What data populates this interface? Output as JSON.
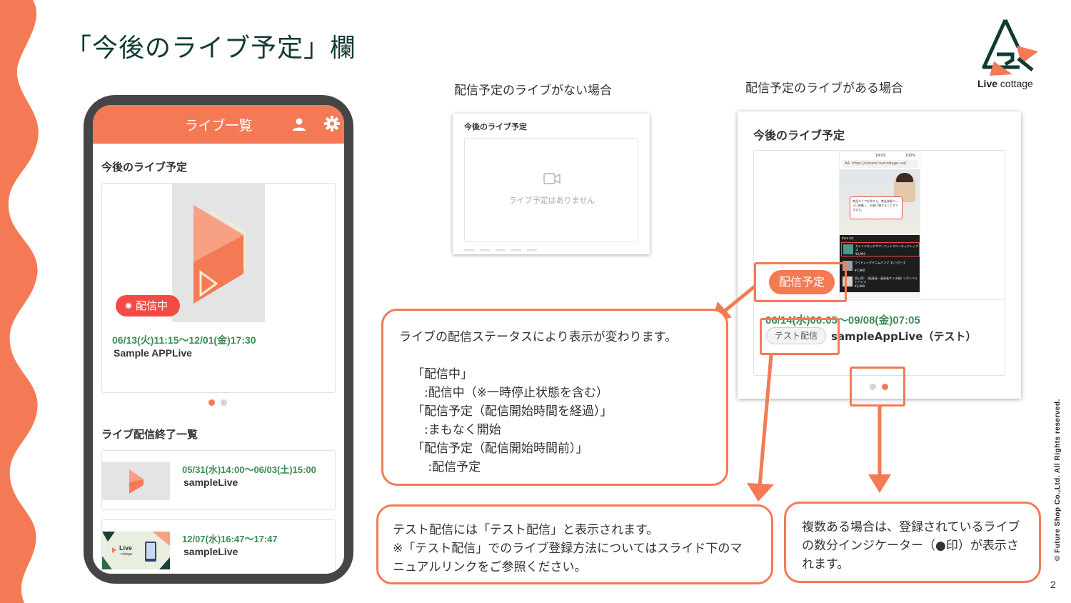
{
  "slide": {
    "title": "「今後のライブ予定」欄",
    "page_number": "2",
    "copyright": "© Future Shop Co.,Ltd. All Rights reserved."
  },
  "logo": {
    "text_bold": "Live",
    "text_regular": "cottage"
  },
  "colors": {
    "accent": "#f47a56",
    "title": "#0f3b33",
    "date_green": "#3d8a55",
    "onair_red": "#f44a45"
  },
  "phone": {
    "header_title": "ライブ一覧",
    "upcoming_title": "今後のライブ予定",
    "live_card": {
      "badge": "配信中",
      "date": "06/13(火)11:15〜12/01(金)17:30",
      "name": "Sample APPLive"
    },
    "ended_title": "ライブ配信終了一覧",
    "ended_items": [
      {
        "date": "05/31(水)14:00〜06/03(土)15:00",
        "name": "sampleLive"
      },
      {
        "date": "12/07(水)16:47〜17:47",
        "name": "sampleLive"
      }
    ],
    "thumb_logo_bold": "Live",
    "thumb_logo_small": "cottage"
  },
  "no_schedule": {
    "caption": "配信予定のライブがない場合",
    "panel_title": "今後のライブ予定",
    "empty_message": "ライブ予定はありません"
  },
  "with_schedule": {
    "caption": "配信予定のライブがある場合",
    "panel_title": "今後のライブ予定",
    "badge": "配信予定",
    "date": "06/14(水)06:05〜09/08(金)07:05",
    "test_badge": "テスト配信",
    "name": "sampleAppLive（テスト）",
    "mini_phone": {
      "time": "19:05",
      "battery": "100%",
      "url_prefix": "AA",
      "url": "https://stream.livecottage.net/",
      "tooltip": "商品エリアを押すと、商品詳細ページに移動し、お買い物することができます。",
      "list_title": "Item list",
      "items": [
        {
          "name": "カシミヤタッチサマーニットクルーネックトップス",
          "price": "¥3,990"
        },
        {
          "name": "ワイドレッグデニムパンツ【ジョガー】",
          "price": "¥7,990"
        },
        {
          "name": "再入荷！【低身長・高身長サイズ有】リボンベルトパンツ",
          "price": "¥2,990"
        }
      ]
    }
  },
  "notes": {
    "status": [
      "ライブの配信ステータスにより表示が変わります。",
      "",
      "「配信中」",
      "　:配信中（※一時停止状態を含む）",
      "「配信予定（配信開始時間を経過）」",
      "　:まもなく開始",
      "「配信予定（配信開始時間前）」",
      "　 :配信予定"
    ],
    "test": [
      "テスト配信には「テスト配信」と表示されます。",
      "※「テスト配信」でのライブ登録方法についてはスライド下のマ",
      "ニュアルリンクをご参照ください。"
    ],
    "indicator": [
      "複数ある場合は、登録されているライブ",
      "の数分インジケーター（●印）が表示さ",
      "れます。"
    ]
  }
}
